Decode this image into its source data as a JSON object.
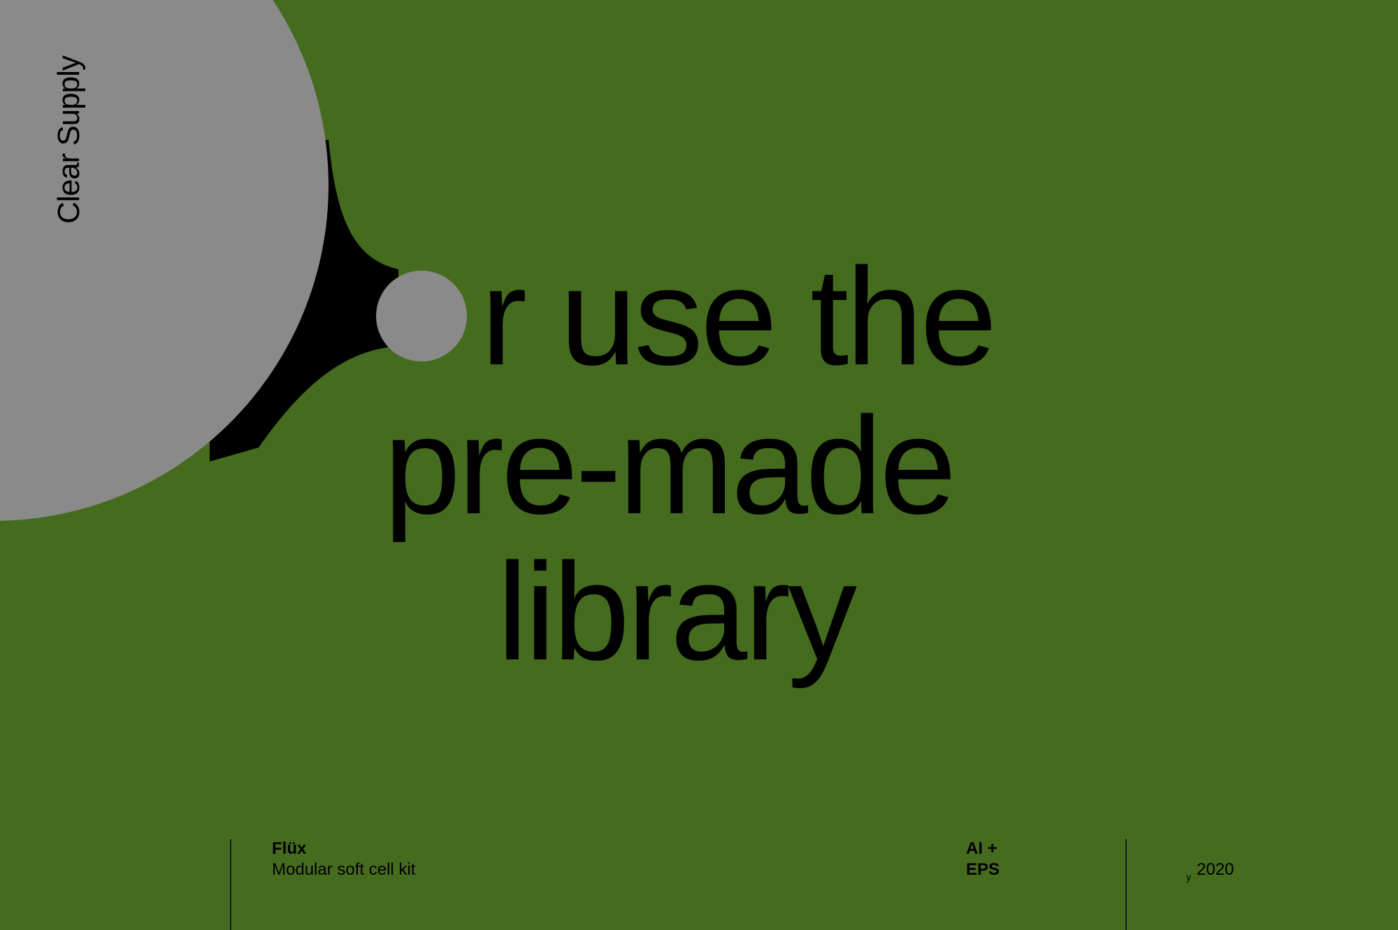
{
  "brand": {
    "name": "Clear Supply"
  },
  "headline": {
    "line1": "r use the",
    "line2": "pre-made",
    "line3": "library"
  },
  "footer": {
    "product_name": "Flüx",
    "product_description": "Modular soft cell kit",
    "formats_line1": "AI +",
    "formats_line2": "EPS",
    "year_mark": "y",
    "year": "2020"
  },
  "colors": {
    "background": "#456b1f",
    "circle": "#8a8a8a",
    "ink": "#000000"
  }
}
